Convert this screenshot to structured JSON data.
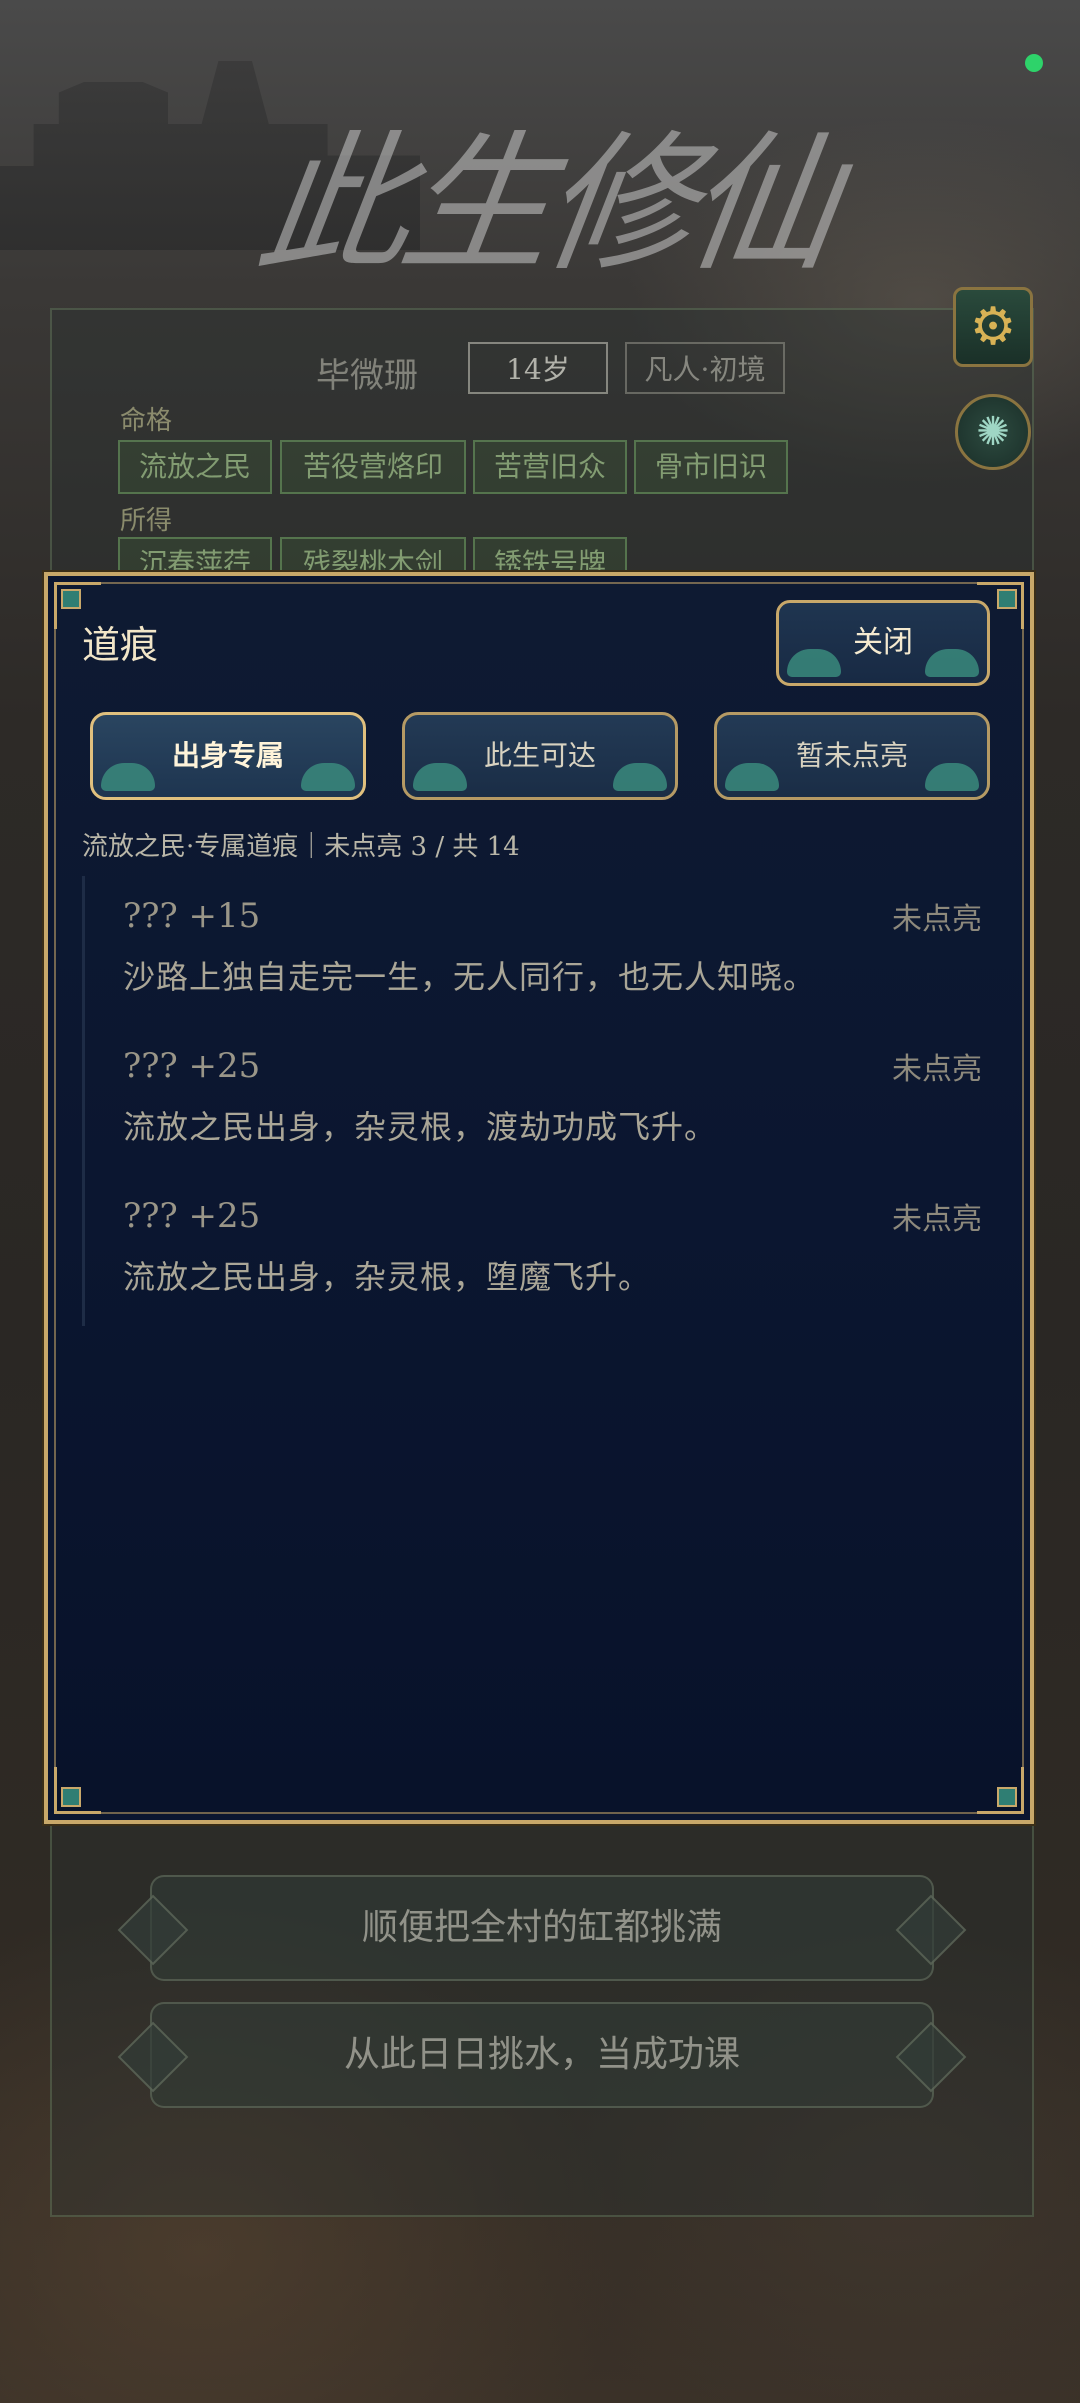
{
  "app": {
    "logo_text": "此生修仙"
  },
  "profile": {
    "name": "毕微珊",
    "age": "14岁",
    "realm": "凡人·初境",
    "fate_label": "命格",
    "fate_tags": [
      "流放之民",
      "苦役营烙印",
      "苦营旧众",
      "骨市旧识"
    ],
    "gains_label": "所得",
    "gains_tags": [
      "沉春萍荇",
      "残裂桃木剑",
      "锈铁号牌"
    ]
  },
  "side_buttons": {
    "settings": "gear-icon",
    "swirl": "swirl-icon"
  },
  "modal": {
    "title": "道痕",
    "close_label": "关闭",
    "tabs": [
      {
        "label": "出身专属",
        "active": true
      },
      {
        "label": "此生可达",
        "active": false
      },
      {
        "label": "暂未点亮",
        "active": false
      }
    ],
    "summary": "流放之民·专属道痕｜未点亮 3 / 共 14",
    "entries": [
      {
        "score": "??? +15",
        "status": "未点亮",
        "desc": "沙路上独自走完一生，无人同行，也无人知晓。"
      },
      {
        "score": "??? +25",
        "status": "未点亮",
        "desc": "流放之民出身，杂灵根，渡劫功成飞升。"
      },
      {
        "score": "??? +25",
        "status": "未点亮",
        "desc": "流放之民出身，杂灵根，堕魔飞升。"
      }
    ]
  },
  "choices": [
    "顺便把全村的缸都挑满",
    "从此日日挑水，当成功课"
  ],
  "colors": {
    "gold": "#c8a86a",
    "modal_bg": "#0b1630",
    "status_dot": "#2ed36a"
  }
}
